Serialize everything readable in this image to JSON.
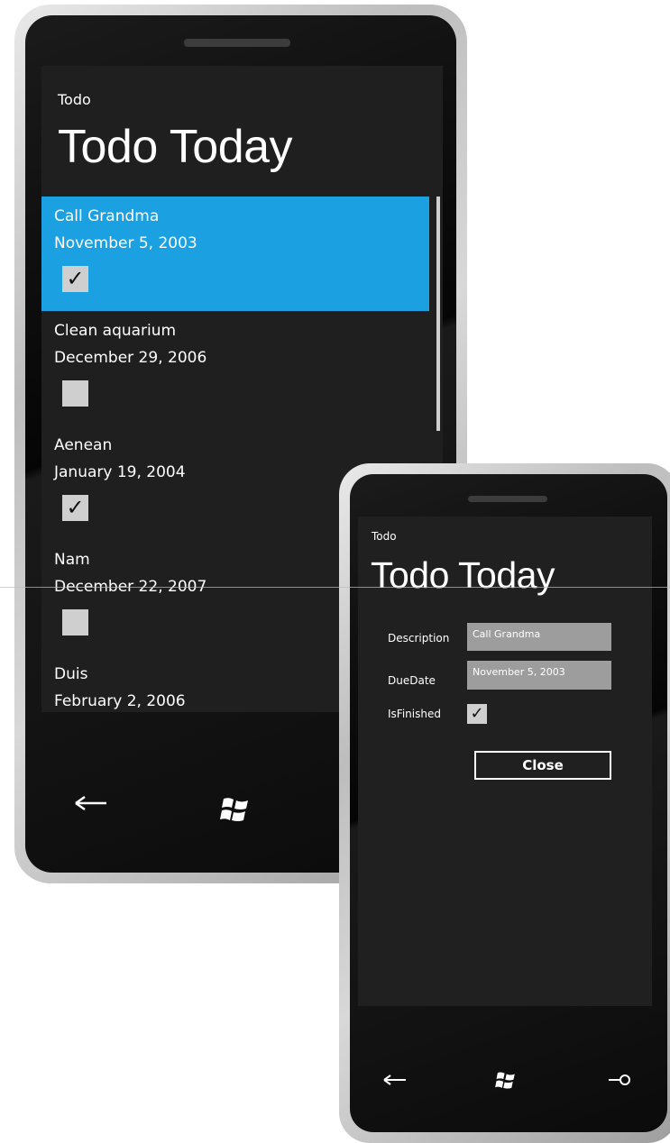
{
  "list_screen": {
    "app_name": "Todo",
    "page_title": "Todo Today",
    "items": [
      {
        "description": "Call Grandma",
        "due_date": "November 5, 2003",
        "finished": true,
        "selected": true
      },
      {
        "description": "Clean aquarium",
        "due_date": "December 29, 2006",
        "finished": false,
        "selected": false
      },
      {
        "description": "Aenean",
        "due_date": "January 19, 2004",
        "finished": true,
        "selected": false
      },
      {
        "description": "Nam",
        "due_date": "December 22, 2007",
        "finished": false,
        "selected": false
      },
      {
        "description": "Duis",
        "due_date": "February 2, 2006",
        "finished": false,
        "selected": false
      }
    ],
    "nav": {
      "back_icon": "back-arrow-icon",
      "start_icon": "windows-logo-icon"
    }
  },
  "detail_screen": {
    "app_name": "Todo",
    "page_title": "Todo Today",
    "description_label": "Description",
    "description_value": "Call Grandma",
    "due_date_label": "DueDate",
    "due_date_value": "November 5, 2003",
    "is_finished_label": "IsFinished",
    "is_finished": true,
    "close_label": "Close",
    "nav": {
      "back_icon": "back-arrow-icon",
      "start_icon": "windows-logo-icon",
      "search_icon": "search-icon"
    }
  },
  "colors": {
    "accent": "#1ba1e2",
    "screen_bg": "#1f1f1f",
    "checkbox": "#cfcfcf",
    "textbox": "#9d9d9d"
  },
  "glyphs": {
    "check": "✓"
  }
}
